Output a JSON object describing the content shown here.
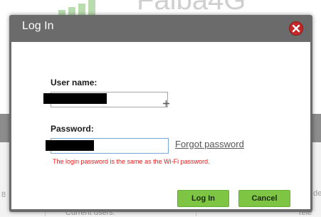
{
  "background": {
    "brand": "Faiba4G",
    "current_users_label": "Current users:",
    "left_fragment": "8",
    "right_fragment_top": "de",
    "right_fragment_bottom": "Tele"
  },
  "dialog": {
    "title": "Log In",
    "close_icon": "close-icon",
    "username": {
      "label": "User name:",
      "value": ""
    },
    "password": {
      "label": "Password:",
      "value": ""
    },
    "forgot_password": "Forgot password",
    "hint": "The login password is the same as the Wi-Fi password.",
    "login_button": "Log In",
    "cancel_button": "Cancel"
  },
  "colors": {
    "title_bar": "#6b6b6b",
    "button_green": "#7ec544",
    "hint_red": "#e11b1b",
    "close_red": "#c62828"
  }
}
